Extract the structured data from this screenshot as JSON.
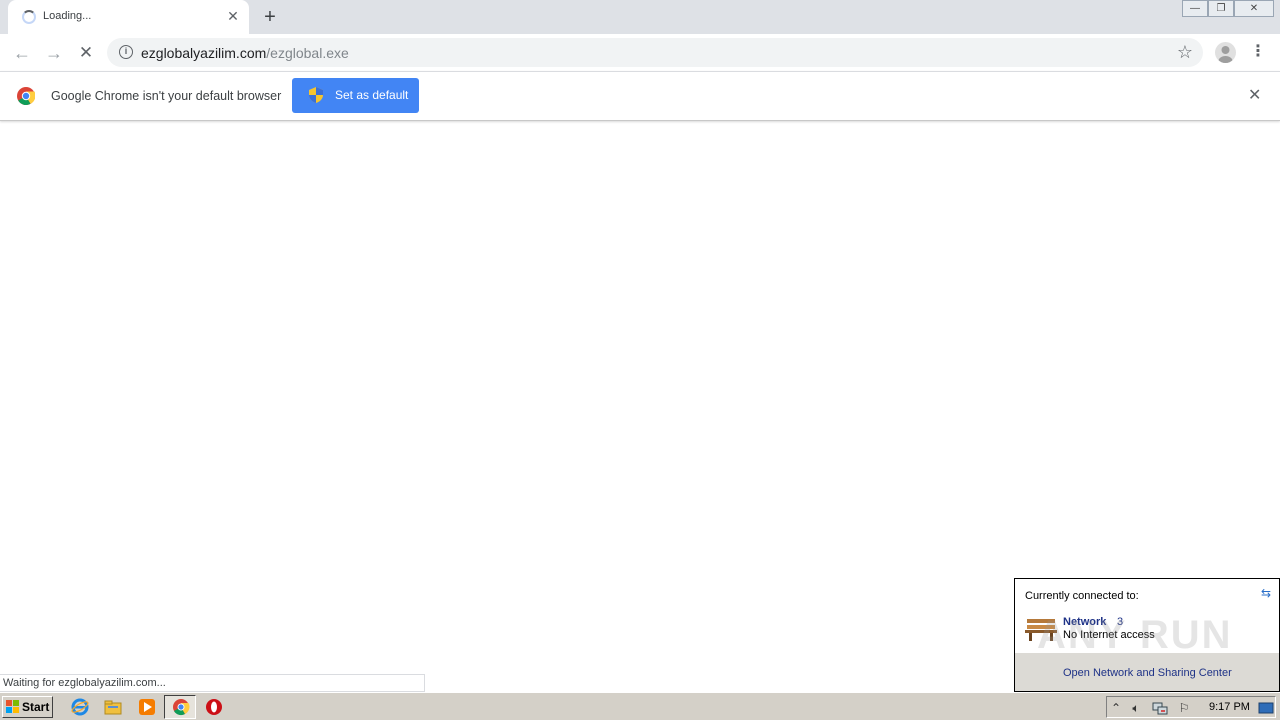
{
  "browser": {
    "tab": {
      "title": "Loading...",
      "close": "✕"
    },
    "new_tab": "+",
    "window_buttons": {
      "minimize": "—",
      "restore": "❐",
      "close": "✕"
    },
    "toolbar": {
      "back": "←",
      "forward": "→",
      "stop": "✕",
      "url_domain": "ezglobalyazilim.com",
      "url_path": "/ezglobal.exe",
      "star": "☆",
      "menu": "⋮"
    },
    "infobar": {
      "message": "Google Chrome isn't your default browser",
      "button_label": "Set as default",
      "close": "✕"
    },
    "status_bubble": "Waiting for ezglobalyazilim.com..."
  },
  "network_popup": {
    "heading": "Currently connected to:",
    "network_name": "Network",
    "network_number": "3",
    "network_status": "No Internet access",
    "link": "Open Network and Sharing Center",
    "watermark": "ANY RUN"
  },
  "taskbar": {
    "start_label": "Start",
    "clock": "9:17 PM",
    "items": [
      "ie-icon",
      "explorer-icon",
      "media-player-icon",
      "chrome-icon",
      "opera-icon"
    ]
  },
  "colors": {
    "accent": "#4285f4",
    "tabstrip": "#dee1e6",
    "taskbar": "#d4d0c8",
    "link": "#1e3287"
  }
}
